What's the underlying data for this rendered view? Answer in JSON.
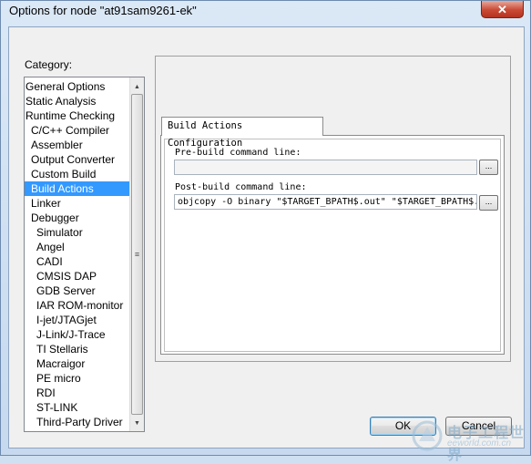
{
  "window": {
    "title": "Options for node \"at91sam9261-ek\""
  },
  "category": {
    "label": "Category:",
    "items": [
      {
        "label": "General Options",
        "level": 0
      },
      {
        "label": "Static Analysis",
        "level": 0
      },
      {
        "label": "Runtime Checking",
        "level": 0
      },
      {
        "label": "C/C++ Compiler",
        "level": 1
      },
      {
        "label": "Assembler",
        "level": 1
      },
      {
        "label": "Output Converter",
        "level": 1
      },
      {
        "label": "Custom Build",
        "level": 1
      },
      {
        "label": "Build Actions",
        "level": 1,
        "selected": true
      },
      {
        "label": "Linker",
        "level": 1
      },
      {
        "label": "Debugger",
        "level": 1
      },
      {
        "label": "Simulator",
        "level": 2
      },
      {
        "label": "Angel",
        "level": 2
      },
      {
        "label": "CADI",
        "level": 2
      },
      {
        "label": "CMSIS DAP",
        "level": 2
      },
      {
        "label": "GDB Server",
        "level": 2
      },
      {
        "label": "IAR ROM-monitor",
        "level": 2
      },
      {
        "label": "I-jet/JTAGjet",
        "level": 2
      },
      {
        "label": "J-Link/J-Trace",
        "level": 2
      },
      {
        "label": "TI Stellaris",
        "level": 2
      },
      {
        "label": "Macraigor",
        "level": 2
      },
      {
        "label": "PE micro",
        "level": 2
      },
      {
        "label": "RDI",
        "level": 2
      },
      {
        "label": "ST-LINK",
        "level": 2
      },
      {
        "label": "Third-Party Driver",
        "level": 2
      }
    ]
  },
  "build_actions": {
    "tab": "Build Actions Configuration",
    "pre_label": "Pre-build command line:",
    "pre_value": "",
    "post_label": "Post-build command line:",
    "post_value": "objcopy -O binary \"$TARGET_BPATH$.out\" \"$TARGET_BPATH$.",
    "browse": "..."
  },
  "buttons": {
    "ok": "OK",
    "cancel": "Cancel"
  },
  "watermark": {
    "text": "电子工程世界",
    "sub": "eeworld.com.cn"
  },
  "icons": {
    "close": "close-icon",
    "scroll_up": "up-arrow-icon",
    "scroll_down": "down-arrow-icon",
    "thumb": "grip-icon"
  }
}
